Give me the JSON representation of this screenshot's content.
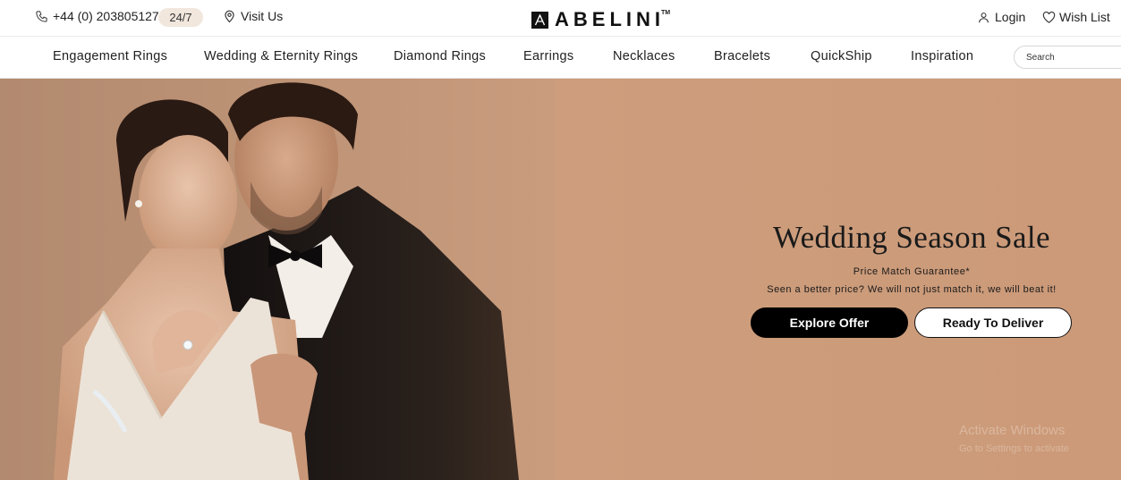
{
  "topbar": {
    "phone": "+44 (0) 2038051270",
    "availability": "24/7",
    "visit": "Visit Us",
    "brand": "ABELINI",
    "brand_tm": "TM",
    "login": "Login",
    "wishlist": "Wish List"
  },
  "nav": {
    "items": [
      {
        "label": "Engagement Rings"
      },
      {
        "label": "Wedding & Eternity Rings"
      },
      {
        "label": "Diamond Rings"
      },
      {
        "label": "Earrings"
      },
      {
        "label": "Necklaces"
      },
      {
        "label": "Bracelets"
      },
      {
        "label": "QuickShip"
      },
      {
        "label": "Inspiration"
      }
    ],
    "search_placeholder": "Search"
  },
  "hero": {
    "title": "Wedding Season Sale",
    "subtitle": "Price Match Guarantee*",
    "description": "Seen a better price? We will not just match it, we will beat it!",
    "primary_cta": "Explore Offer",
    "secondary_cta": "Ready To Deliver",
    "background_color": "#cc9a78"
  },
  "overlay": {
    "line1": "Activate Windows",
    "line2": "Go to Settings to activate"
  },
  "icons": {
    "phone": "phone-icon",
    "location": "location-pin-icon",
    "user": "user-icon",
    "heart": "heart-icon",
    "brand_mark": "abelini-logo-mark-icon"
  }
}
